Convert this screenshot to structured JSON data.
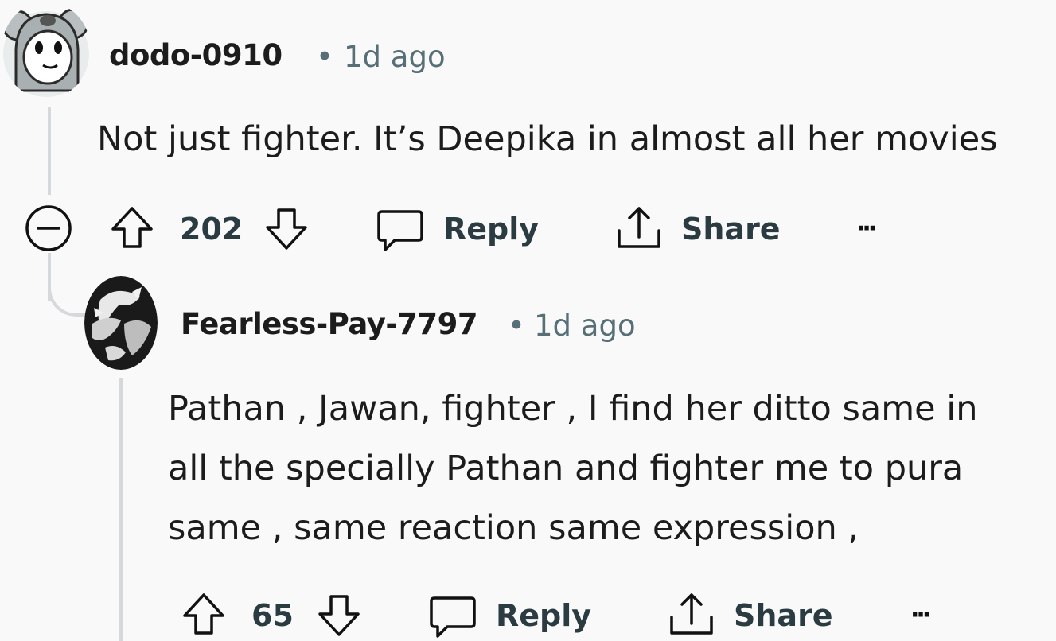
{
  "comment": {
    "author": "dodo-0910",
    "separator": "•",
    "time": "1d ago",
    "text": "Not just fighter. It’s Deepika in almost all her movies",
    "votes": "202",
    "reply_label": "Reply",
    "share_label": "Share",
    "more_label": "···"
  },
  "reply": {
    "author": "Fearless-Pay-7797",
    "separator": "•",
    "time": "1d ago",
    "lines": [
      "Pathan , Jawan, fighter , I find her ditto same in",
      "all the specially Pathan and fighter me to pura",
      "same , same reaction same expression ,"
    ],
    "votes": "65",
    "reply_label": "Reply",
    "share_label": "Share",
    "more_label": "···"
  }
}
